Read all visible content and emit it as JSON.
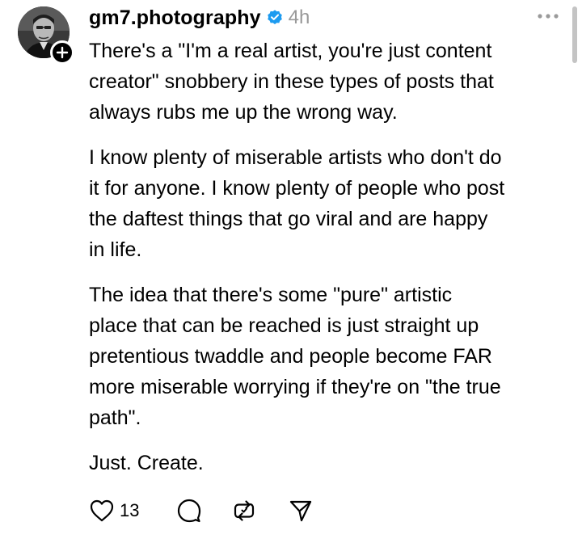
{
  "author": {
    "username": "gm7.photography",
    "verified_icon": "verified-badge-icon",
    "timestamp": "4h",
    "avatar_icon": "avatar",
    "follow_icon": "plus-icon"
  },
  "post": {
    "paragraphs": [
      {
        "lines": [
          "There's a \"I'm a real artist, you're just content",
          "creator\" snobbery in these types of posts that",
          "always rubs me up the wrong way."
        ]
      },
      {
        "lines": [
          "I know plenty of miserable artists who don't do",
          "it for anyone. I know plenty of people who post",
          "the daftest things that go viral and are happy",
          "in life."
        ]
      },
      {
        "lines": [
          "The idea that there's some \"pure\" artistic",
          "place that can be reached is just straight up",
          "pretentious twaddle and people become FAR",
          "more miserable worrying if they're on \"the true",
          "path\"."
        ]
      },
      {
        "lines": [
          "Just. Create."
        ]
      }
    ]
  },
  "actions": {
    "like_count": "13",
    "icons": [
      "heart-icon",
      "comment-icon",
      "repost-icon",
      "share-icon"
    ]
  },
  "colors": {
    "text": "#000000",
    "muted": "#999999",
    "verified": "#1d9bf0",
    "badge": "#000000"
  }
}
